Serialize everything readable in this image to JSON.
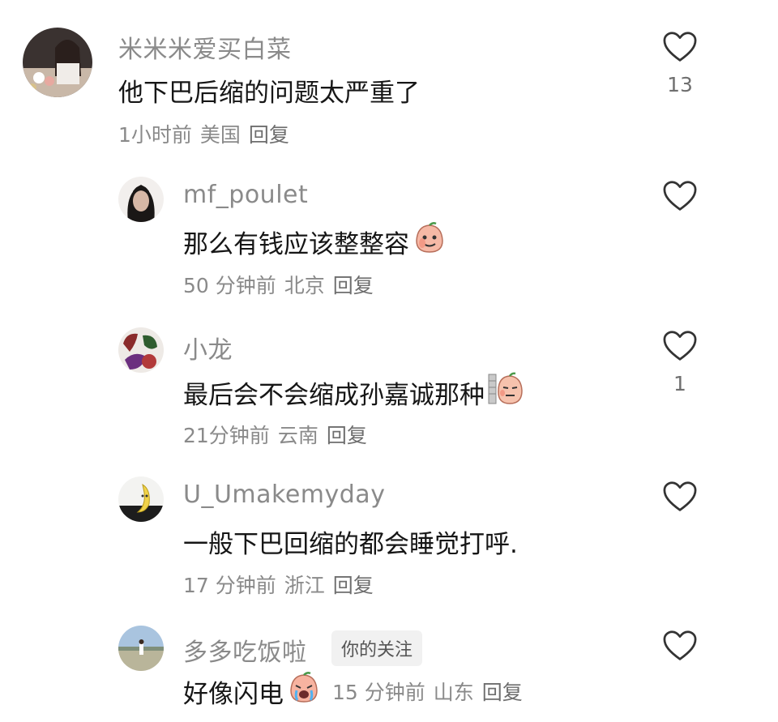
{
  "comments": [
    {
      "username": "米米米爱买白菜",
      "text": "他下巴后缩的问题太严重了",
      "time": "1小时前",
      "location": "美国",
      "reply": "回复",
      "likes": "13"
    },
    {
      "username": "mf_poulet",
      "text": "那么有钱应该整整容",
      "time": "50 分钟前",
      "location": "北京",
      "reply": "回复",
      "likes": ""
    },
    {
      "username": "小龙",
      "text": "最后会不会缩成孙嘉诚那种",
      "time": "21分钟前",
      "location": "云南",
      "reply": "回复",
      "likes": "1"
    },
    {
      "username": "U_Umakemyday",
      "text": "一般下巴回缩的都会睡觉打呼.",
      "time": "17 分钟前",
      "location": "浙江",
      "reply": "回复",
      "likes": ""
    },
    {
      "username": "多多吃饭啦",
      "badge": "你的关注",
      "text": "好像闪电",
      "time": "15 分钟前",
      "location": "山东",
      "reply": "回复",
      "likes": ""
    }
  ],
  "icons": {
    "like": "heart-outline-icon",
    "emoji": "peach-sticker-icon"
  },
  "colors": {
    "meta_text": "#8a8a8a",
    "body_text": "#161616",
    "badge_bg": "#f1f1f1"
  }
}
